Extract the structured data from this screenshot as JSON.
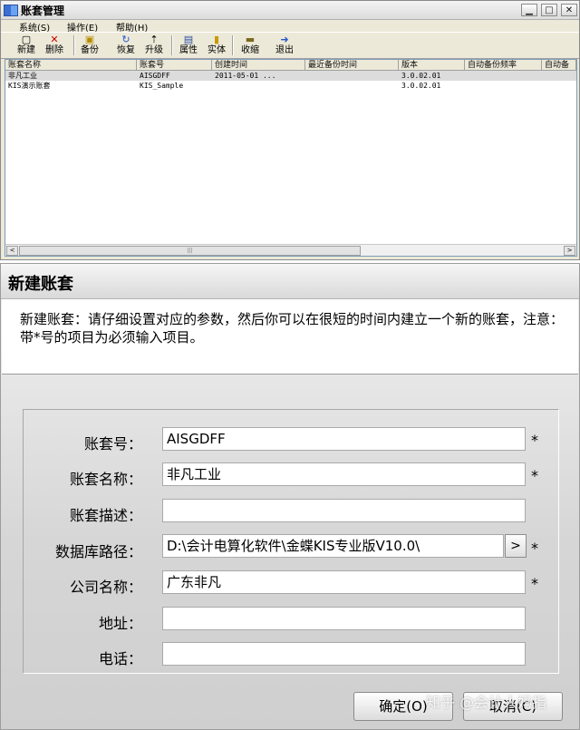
{
  "window": {
    "title": "账套管理",
    "controls": {
      "minimize": "▁",
      "maximize": "□",
      "close": "✕"
    }
  },
  "menu": [
    "系统(S)",
    "操作(E)",
    "帮助(H)"
  ],
  "toolbar": [
    {
      "label": "新建",
      "icon": "new-file-icon",
      "glyph": "▢"
    },
    {
      "label": "删除",
      "icon": "delete-icon",
      "glyph": "✕"
    },
    {
      "label": "备份",
      "icon": "backup-icon",
      "glyph": "▣"
    },
    {
      "label": "恢复",
      "icon": "restore-icon",
      "glyph": "↻"
    },
    {
      "label": "升级",
      "icon": "upgrade-icon",
      "glyph": "⇡"
    },
    {
      "label": "属性",
      "icon": "properties-icon",
      "glyph": "▤"
    },
    {
      "label": "实体",
      "icon": "entity-icon",
      "glyph": "▮"
    },
    {
      "label": "收缩",
      "icon": "shrink-icon",
      "glyph": "▬"
    },
    {
      "label": "退出",
      "icon": "exit-icon",
      "glyph": "➜"
    }
  ],
  "list": {
    "columns": [
      "账套名称",
      "账套号",
      "创建时间",
      "最近备份时间",
      "版本",
      "自动备份频率",
      "自动备"
    ],
    "rows": [
      {
        "name": "非凡工业",
        "code": "AISGDFF",
        "created": "2011-05-01 ...",
        "backup": "",
        "version": "3.0.02.01",
        "freq": "",
        "auto": ""
      },
      {
        "name": "KIS演示账套",
        "code": "KIS_Sample",
        "created": "",
        "backup": "",
        "version": "3.0.02.01",
        "freq": "",
        "auto": ""
      }
    ],
    "scroll_left": "<",
    "scroll_right": ">",
    "scroll_grip": "|||"
  },
  "dialog": {
    "title": "新建账套",
    "description": "新建账套：请仔细设置对应的参数，然后你可以在很短的时间内建立一个新的账套，注意：带*号的项目为必须输入项目。",
    "fields": [
      {
        "label": "账套号：",
        "value": "AISGDFF",
        "required": "*"
      },
      {
        "label": "账套名称：",
        "value": "非凡工业",
        "required": "*"
      },
      {
        "label": "账套描述：",
        "value": "",
        "required": ""
      },
      {
        "label": "数据库路径：",
        "value": "D:\\会计电算化软件\\金蝶KIS专业版V10.0\\",
        "required": "*"
      },
      {
        "label": "公司名称：",
        "value": "广东非凡",
        "required": "*"
      },
      {
        "label": "地址：",
        "value": "",
        "required": ""
      },
      {
        "label": "电话：",
        "value": "",
        "required": ""
      }
    ],
    "browse": ">",
    "ok": "确定(O)",
    "cancel": "取消(C)",
    "watermark": "知乎 @会计人妈指"
  }
}
